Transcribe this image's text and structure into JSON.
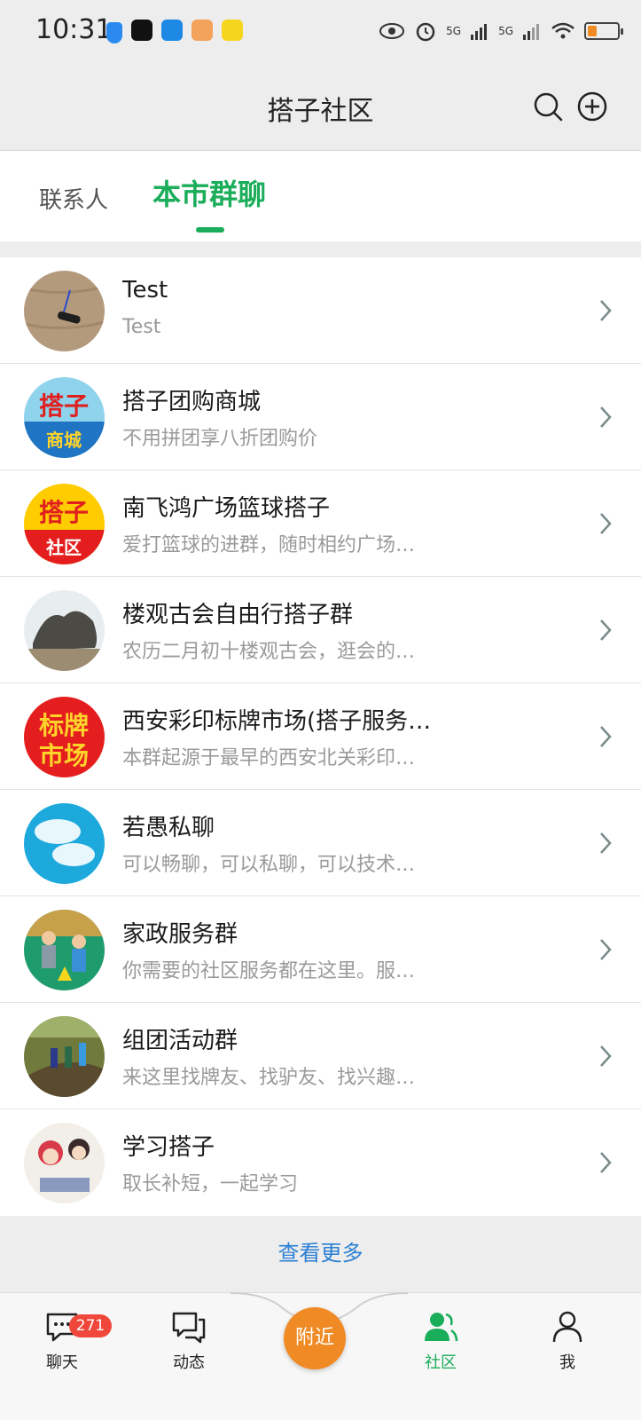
{
  "status_bar": {
    "time": "10:31",
    "signal_label_1": "5G",
    "signal_label_2": "5G",
    "battery_level": 0.3
  },
  "header": {
    "title": "搭子社区",
    "search_icon": "search-icon",
    "add_icon": "plus-circle-icon"
  },
  "tabs": {
    "contacts": "联系人",
    "city_groups": "本市群聊"
  },
  "groups": [
    {
      "title": "Test",
      "subtitle": "Test"
    },
    {
      "title": "搭子团购商城",
      "subtitle": "不用拼团享八折团购价"
    },
    {
      "title": "南飞鸿广场篮球搭子",
      "subtitle": "爱打篮球的进群，随时相约广场…"
    },
    {
      "title": "楼观古会自由行搭子群",
      "subtitle": "农历二月初十楼观古会，逛会的…"
    },
    {
      "title": "西安彩印标牌市场(搭子服务…",
      "subtitle": "本群起源于最早的西安北关彩印…"
    },
    {
      "title": "若愚私聊",
      "subtitle": "可以畅聊，可以私聊，可以技术…"
    },
    {
      "title": "家政服务群",
      "subtitle": "你需要的社区服务都在这里。服…"
    },
    {
      "title": "组团活动群",
      "subtitle": "来这里找牌友、找驴友、找兴趣…"
    },
    {
      "title": "学习搭子",
      "subtitle": "取长补短，一起学习"
    }
  ],
  "avatar_text": {
    "g2_top": "搭子",
    "g2_bottom": "商城",
    "g3_top": "搭子",
    "g3_bottom": "社区",
    "g5_top": "标牌",
    "g5_bottom": "市场"
  },
  "view_more": "查看更多",
  "tabbar": {
    "chat": "聊天",
    "chat_badge": "271",
    "moments": "动态",
    "nearby": "附近",
    "community": "社区",
    "me": "我"
  },
  "colors": {
    "accent": "#1aad5a",
    "link": "#2a7fd4",
    "badge": "#f0473c",
    "fab": "#f08a24"
  }
}
